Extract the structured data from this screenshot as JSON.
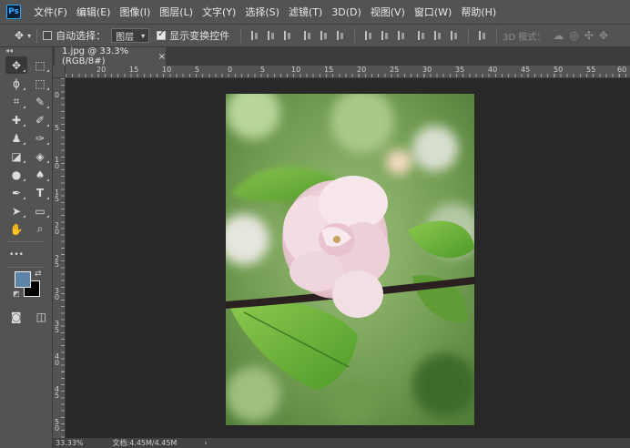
{
  "menu": {
    "logo": "Ps",
    "items": [
      "文件(F)",
      "编辑(E)",
      "图像(I)",
      "图层(L)",
      "文字(Y)",
      "选择(S)",
      "滤镜(T)",
      "3D(D)",
      "视图(V)",
      "窗口(W)",
      "帮助(H)"
    ]
  },
  "options": {
    "auto_select_label": "自动选择：",
    "auto_select_checked": false,
    "auto_select_target": "图层",
    "show_transform_label": "显示变换控件",
    "show_transform_checked": true,
    "mode_3d_label": "3D 模式："
  },
  "document": {
    "tab_title": "1.jpg @ 33.3%(RGB/8#)",
    "close_glyph": "×"
  },
  "rulers": {
    "horizontal": [
      "20",
      "15",
      "10",
      "5",
      "0",
      "5",
      "10",
      "15",
      "20",
      "25",
      "30",
      "35",
      "40",
      "45",
      "50",
      "55",
      "60"
    ],
    "vertical": [
      "0",
      "5",
      "1 0",
      "1 5",
      "2 0",
      "2 5",
      "3 0",
      "3 5",
      "4 0",
      "4 5",
      "5 0"
    ]
  },
  "toolbar": {
    "collapse_glyph": "◂◂",
    "tools": [
      {
        "name": "move-tool",
        "glyph": "✥",
        "active": true
      },
      {
        "name": "marquee-tool",
        "glyph": "⬚"
      },
      {
        "name": "lasso-tool",
        "glyph": "ϕ"
      },
      {
        "name": "object-select-tool",
        "glyph": "⬚"
      },
      {
        "name": "crop-tool",
        "glyph": "⌗"
      },
      {
        "name": "eyedropper-tool",
        "glyph": "✎"
      },
      {
        "name": "healing-tool",
        "glyph": "✚"
      },
      {
        "name": "brush-tool",
        "glyph": "✐"
      },
      {
        "name": "stamp-tool",
        "glyph": "♟"
      },
      {
        "name": "history-brush-tool",
        "glyph": "✑"
      },
      {
        "name": "eraser-tool",
        "glyph": "◪"
      },
      {
        "name": "paint-bucket-tool",
        "glyph": "◈"
      },
      {
        "name": "blur-tool",
        "glyph": "●"
      },
      {
        "name": "dodge-tool",
        "glyph": "♠"
      },
      {
        "name": "pen-tool",
        "glyph": "✒"
      },
      {
        "name": "type-tool",
        "glyph": "T"
      },
      {
        "name": "path-select-tool",
        "glyph": "➤"
      },
      {
        "name": "rectangle-tool",
        "glyph": "▭"
      },
      {
        "name": "hand-tool",
        "glyph": "✋"
      },
      {
        "name": "zoom-tool",
        "glyph": "⌕"
      }
    ],
    "more_glyph": "•••",
    "fg_color": "#5b84a7",
    "bg_color": "#000000",
    "quickmask_glyph": "◙",
    "screenmode_glyph": "◫"
  },
  "status": {
    "zoom": "33.33%",
    "doc_info": "文档:4.45M/4.45M",
    "arrow": "›"
  }
}
